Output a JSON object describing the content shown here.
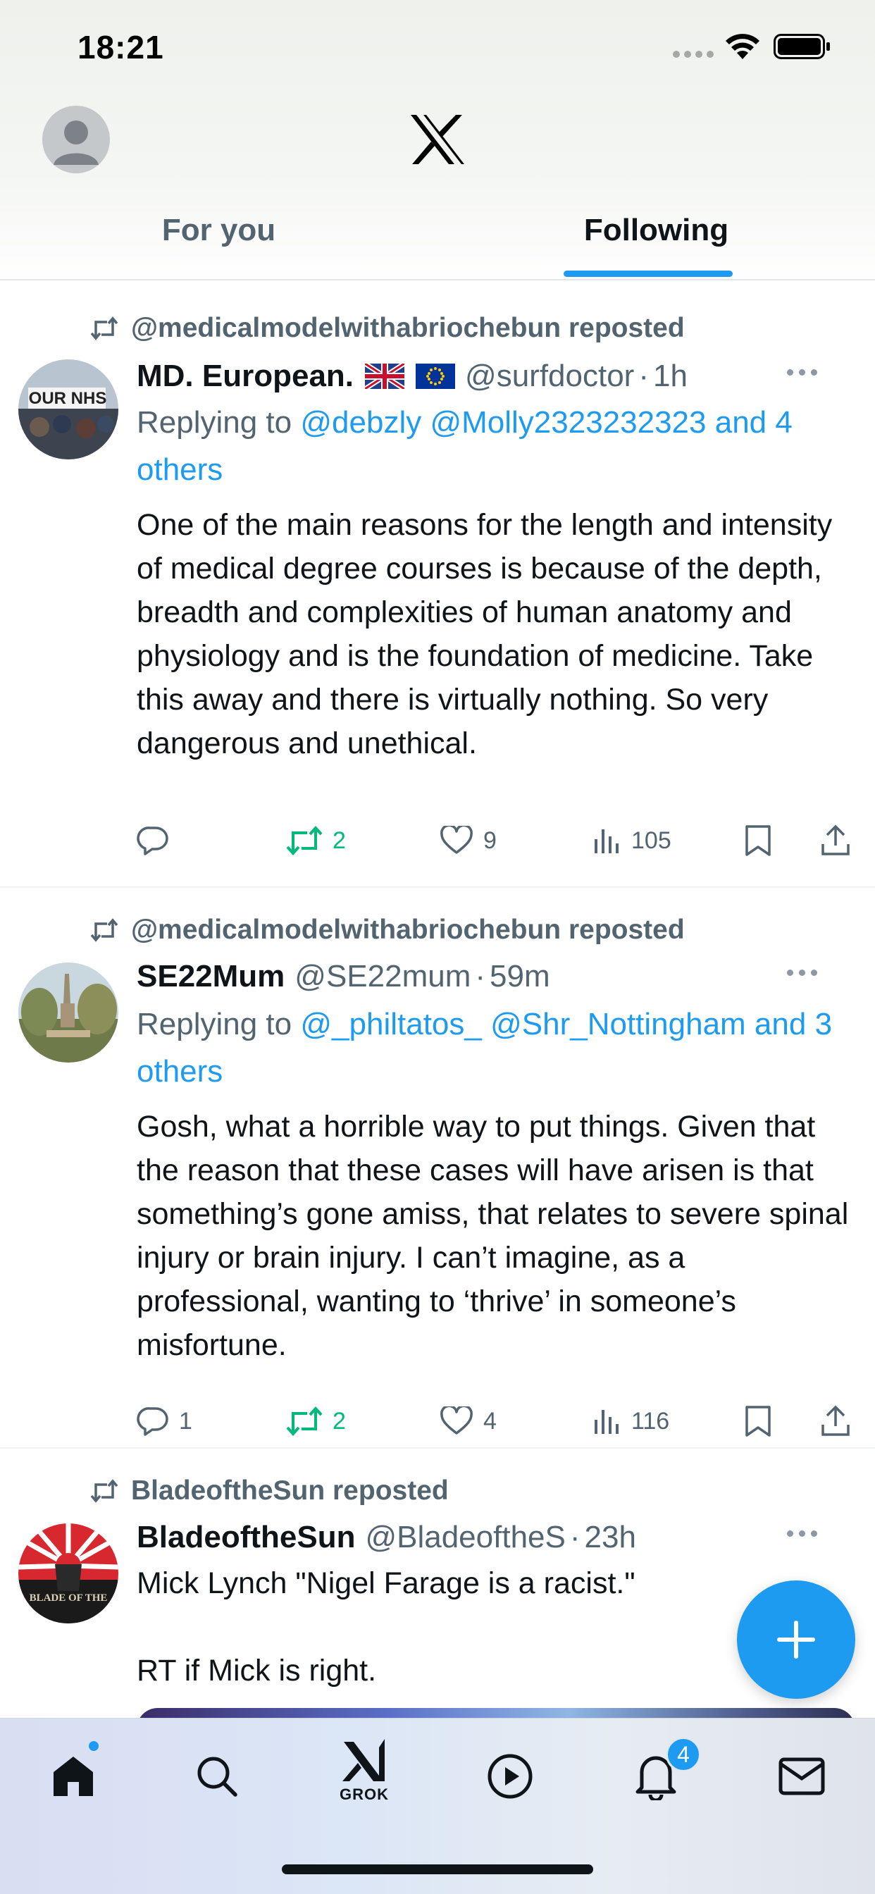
{
  "status_bar": {
    "time": "18:21"
  },
  "header": {
    "logo": "x-logo",
    "tabs": [
      {
        "label": "For you",
        "selected": false
      },
      {
        "label": "Following",
        "selected": true
      }
    ]
  },
  "tweets": [
    {
      "context": "@medicalmodelwithabriochebun reposted",
      "display_name": "MD. European.",
      "handle": "@surfdoctor",
      "time_sep": "·",
      "time": "1h",
      "replying_prefix": "Replying to",
      "replying_mentions": "@debzly @Molly2323232323 and 4 others",
      "text": "One of the main reasons for the length and intensity of medical degree courses is because of the depth, breadth and complexities of human anatomy and physiology and is the foundation of medicine. Take this away and there is virtually nothing.  So very dangerous and unethical.",
      "replies": "",
      "reposts": "2",
      "likes": "9",
      "views": "105"
    },
    {
      "context": "@medicalmodelwithabriochebun reposted",
      "display_name": "SE22Mum",
      "handle": "@SE22mum",
      "time_sep": "·",
      "time": "59m",
      "replying_prefix": "Replying to",
      "replying_mentions": "@_philtatos_ @Shr_Nottingham and 3 others",
      "text": "Gosh, what a horrible way to put things. Given that the reason that these cases will have arisen is that something’s gone amiss, that relates to severe spinal injury or brain injury. I can’t imagine, as a professional, wanting to ‘thrive’ in someone’s misfortune.",
      "replies": "1",
      "reposts": "2",
      "likes": "4",
      "views": "116"
    },
    {
      "context": "BladeoftheSun reposted",
      "display_name": "BladeoftheSun",
      "handle": "@BladeoftheS",
      "time_sep": "·",
      "time": "23h",
      "text": "Mick Lynch \"Nigel Farage is a racist.\"\n\nRT if Mick is right.",
      "avatar_text": "BLADE OF THE"
    }
  ],
  "avatar_1_text": "OUR NHS",
  "bottom_nav": {
    "items": [
      "home-icon",
      "search-icon",
      "grok-icon",
      "video-icon",
      "notifications-icon",
      "messages-icon"
    ],
    "grok_label": "GROK",
    "notification_count": "4"
  },
  "colors": {
    "accent": "#1d9bf0",
    "repost_green": "#00ba7c",
    "secondary_text": "#536471"
  }
}
